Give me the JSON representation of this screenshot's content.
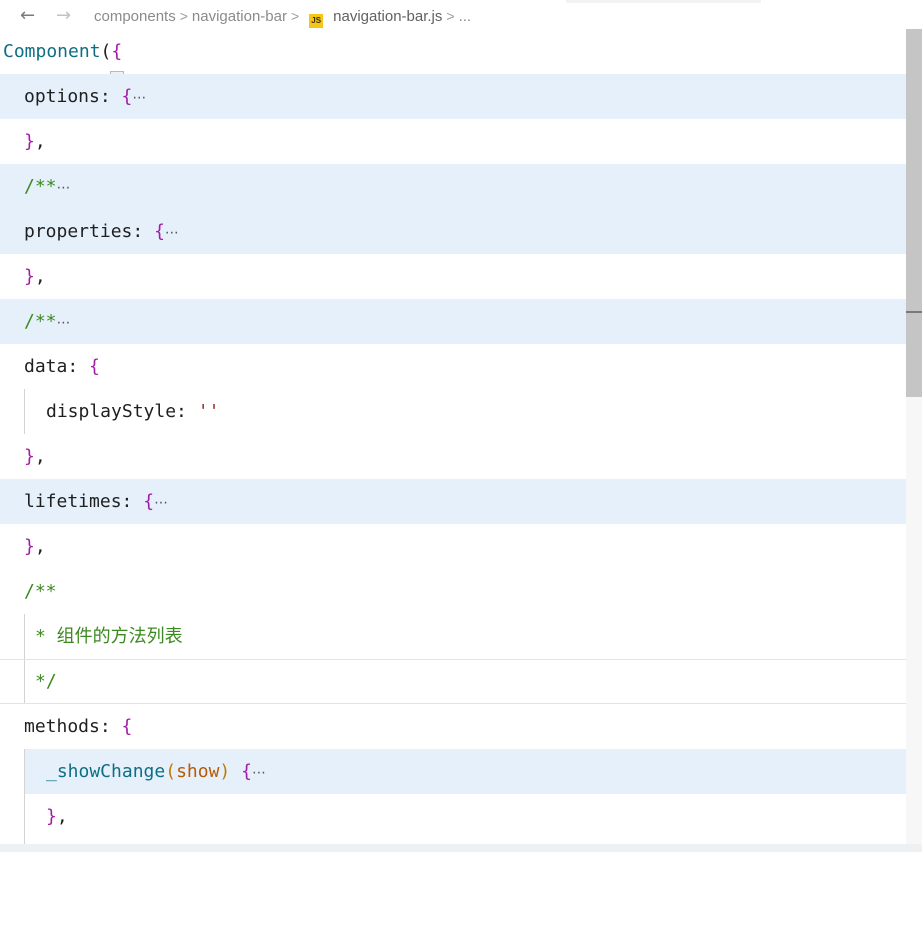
{
  "nav": {
    "back_glyph": "←",
    "forward_glyph": "→"
  },
  "breadcrumb": {
    "items": [
      "components",
      "navigation-bar",
      "navigation-bar.js",
      "..."
    ],
    "separator": ">",
    "file_icon_label": "JS"
  },
  "code": {
    "l1_id": "Component",
    "l1_paren": "(",
    "l1_brace": "{",
    "options_key": "options",
    "colon": ":",
    "open_brace": "{",
    "ellipsis": "⋯",
    "close_brace": "}",
    "comma": ",",
    "doc_open": "/**",
    "properties_key": "properties",
    "data_key": "data",
    "displayStyle_key": "displayStyle",
    "displayStyle_val": "''",
    "lifetimes_key": "lifetimes",
    "comment_line": "* 组件的方法列表",
    "comment_close": "*/",
    "methods_key": "methods",
    "fn_name": "_showChange",
    "fn_paren_open": "(",
    "fn_param": "show",
    "fn_paren_close": ")"
  },
  "colors": {
    "highlight": "#e5f0fb",
    "brace": "#a21ca6",
    "comment": "#3b8a1f",
    "identifier": "#0e6e83",
    "parameter": "#b85a00"
  }
}
